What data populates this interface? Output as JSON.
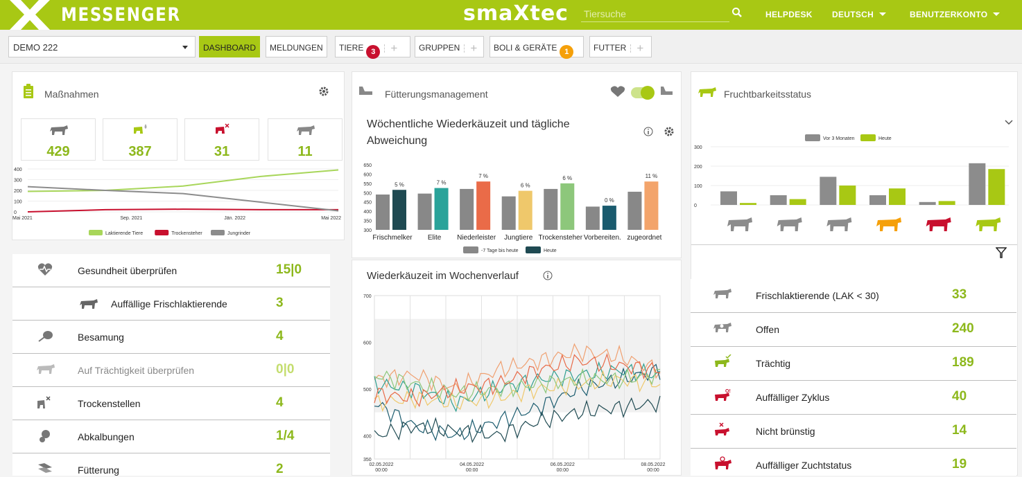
{
  "header": {
    "app_name": "MESSENGER",
    "brand": "smaXtec",
    "search_placeholder": "Tiersuche",
    "helpdesk": "HELPDESK",
    "language": "DEUTSCH",
    "account": "BENUTZERKONTO"
  },
  "toolbar": {
    "farm": "DEMO 222",
    "nav": {
      "dashboard": "DASHBOARD",
      "meldungen": "MELDUNGEN",
      "tiere": "TIERE",
      "tiere_badge": "3",
      "gruppen": "GRUPPEN",
      "boli": "BOLI & GERÄTE",
      "boli_badge": "1",
      "futter": "FUTTER"
    },
    "badge_colors": {
      "tiere": "#c8102e",
      "boli": "#f5a00a"
    }
  },
  "massnahmen": {
    "title": "Maßnahmen",
    "kpis": [
      {
        "value": "429",
        "icon": "cow-icon"
      },
      {
        "value": "387",
        "icon": "lactating-icon"
      },
      {
        "value": "31",
        "icon": "dry-cow-icon"
      },
      {
        "value": "11",
        "icon": "heifer-icon"
      }
    ],
    "chart_data": {
      "type": "line",
      "x": [
        "Mai 2021",
        "Sep. 2021",
        "Jän. 2022",
        "Mai 2022"
      ],
      "ylim": [
        0,
        400
      ],
      "yticks": [
        "400",
        "300",
        "200",
        "100",
        "0"
      ],
      "series": [
        {
          "name": "Laktierende Tiere",
          "color": "#a8d65a",
          "values": [
            190,
            200,
            240,
            330,
            390
          ]
        },
        {
          "name": "Trockensteher",
          "color": "#c8102e",
          "values": [
            0,
            20,
            25,
            20,
            20
          ]
        },
        {
          "name": "Jungrinder",
          "color": "#8c8c8c",
          "values": [
            235,
            200,
            170,
            90,
            10
          ]
        }
      ]
    },
    "items": [
      {
        "label": "Gesundheit überprüfen",
        "value": "15|0",
        "icon": "heart-rate-icon"
      },
      {
        "label": "Auffällige Frischlaktierende",
        "value": "3",
        "icon": "cow-icon"
      },
      {
        "label": "Besamung",
        "value": "4",
        "icon": "insemination-icon"
      },
      {
        "label": "Auf Trächtigkeit überprüfen",
        "value": "0|0",
        "icon": "pregnancy-check-icon"
      },
      {
        "label": "Trockenstellen",
        "value": "4",
        "icon": "dry-off-icon"
      },
      {
        "label": "Abkalbungen",
        "value": "1/4",
        "icon": "calving-icon"
      },
      {
        "label": "Fütterung",
        "value": "2",
        "icon": "feeding-icon"
      }
    ]
  },
  "fuetterung": {
    "title": "Fütterungsmanagement",
    "subtitle": "Wöchentliche Wiederkäuzeit und tägliche Abweichung",
    "chart_data": {
      "type": "bar",
      "categories": [
        "Frischmelker",
        "Elite",
        "Niederleister",
        "Jungtiere",
        "Trockensteher",
        "Vorbereiten.",
        "zugeordnet"
      ],
      "ylim": [
        300,
        650
      ],
      "yticks": [
        "650",
        "600",
        "550",
        "500",
        "450",
        "400",
        "350",
        "300"
      ],
      "series": [
        {
          "name": "-7 Tage bis heute",
          "values": [
            490,
            495,
            520,
            480,
            520,
            425,
            505
          ]
        },
        {
          "name": "Heute",
          "values": [
            515,
            525,
            560,
            510,
            550,
            430,
            560
          ]
        }
      ],
      "labels": [
        "5 %",
        "7 %",
        "7 %",
        "6 %",
        "6 %",
        "0 %",
        "11 %"
      ],
      "today_colors": [
        "#1f4a52",
        "#2aa39a",
        "#ea6b48",
        "#efc86b",
        "#8dc77b",
        "#1a5b6e",
        "#f3a46b"
      ]
    },
    "weekly": {
      "title": "Wiederkäuzeit im Wochenverlauf",
      "chart_data": {
        "type": "line",
        "x": [
          "02.05.2022 00:00",
          "04.05.2022 00:00",
          "06.05.2022 00:00",
          "08.05.2022 00:00"
        ],
        "ylim": [
          350,
          700
        ],
        "yticks": [
          "700",
          "600",
          "500",
          "400",
          "350"
        ],
        "series": [
          {
            "color": "#f0a070",
            "values": [
              520,
              530,
              500,
              540,
              560,
              580,
              570,
              540
            ]
          },
          {
            "color": "#2e9e8f",
            "values": [
              510,
              500,
              470,
              500,
              520,
              530,
              540,
              530
            ]
          },
          {
            "color": "#1a5b6e",
            "values": [
              470,
              420,
              400,
              430,
              460,
              500,
              520,
              540
            ]
          },
          {
            "color": "#efc86b",
            "values": [
              470,
              480,
              470,
              480,
              500,
              510,
              520,
              510
            ]
          },
          {
            "color": "#8dc77b",
            "values": [
              530,
              510,
              490,
              500,
              510,
              520,
              520,
              530
            ]
          },
          {
            "color": "#e86a48",
            "values": [
              490,
              480,
              500,
              510,
              540,
              560,
              550,
              540
            ]
          },
          {
            "color": "#1f4a52",
            "values": [
              400,
              420,
              410,
              400,
              430,
              450,
              460,
              470
            ]
          }
        ]
      }
    }
  },
  "frucht": {
    "title": "Fruchtbarkeitsstatus",
    "chart_data": {
      "type": "bar",
      "ylim": [
        0,
        300
      ],
      "yticks": [
        "300",
        "200",
        "100",
        "0"
      ],
      "series": [
        {
          "name": "Vor 3 Monaten",
          "color": "#8c8c8c",
          "values": [
            70,
            50,
            145,
            50,
            15,
            215
          ]
        },
        {
          "name": "Heute",
          "color": "#a8c814",
          "values": [
            10,
            30,
            100,
            85,
            20,
            185
          ]
        }
      ],
      "category_colors": [
        "#8c8c8c",
        "#8c8c8c",
        "#8c8c8c",
        "#f5a00a",
        "#c8102e",
        "#a8c814"
      ]
    },
    "items": [
      {
        "label": "Frischlaktierende (LAK < 30)",
        "value": "33",
        "icon": "fresh-cow-icon",
        "color": "#8c8c8c"
      },
      {
        "label": "Offen",
        "value": "240",
        "icon": "open-cow-icon",
        "color": "#8c8c8c"
      },
      {
        "label": "Trächtig",
        "value": "189",
        "icon": "pregnant-icon",
        "color": "#8db81c"
      },
      {
        "label": "Auffälliger Zyklus",
        "value": "40",
        "icon": "cycle-alert-icon",
        "color": "#c8102e"
      },
      {
        "label": "Nicht brünstig",
        "value": "14",
        "icon": "not-in-heat-icon",
        "color": "#c8102e"
      },
      {
        "label": "Auffälliger Zuchtstatus",
        "value": "19",
        "icon": "breeding-alert-icon",
        "color": "#c8102e"
      }
    ]
  }
}
